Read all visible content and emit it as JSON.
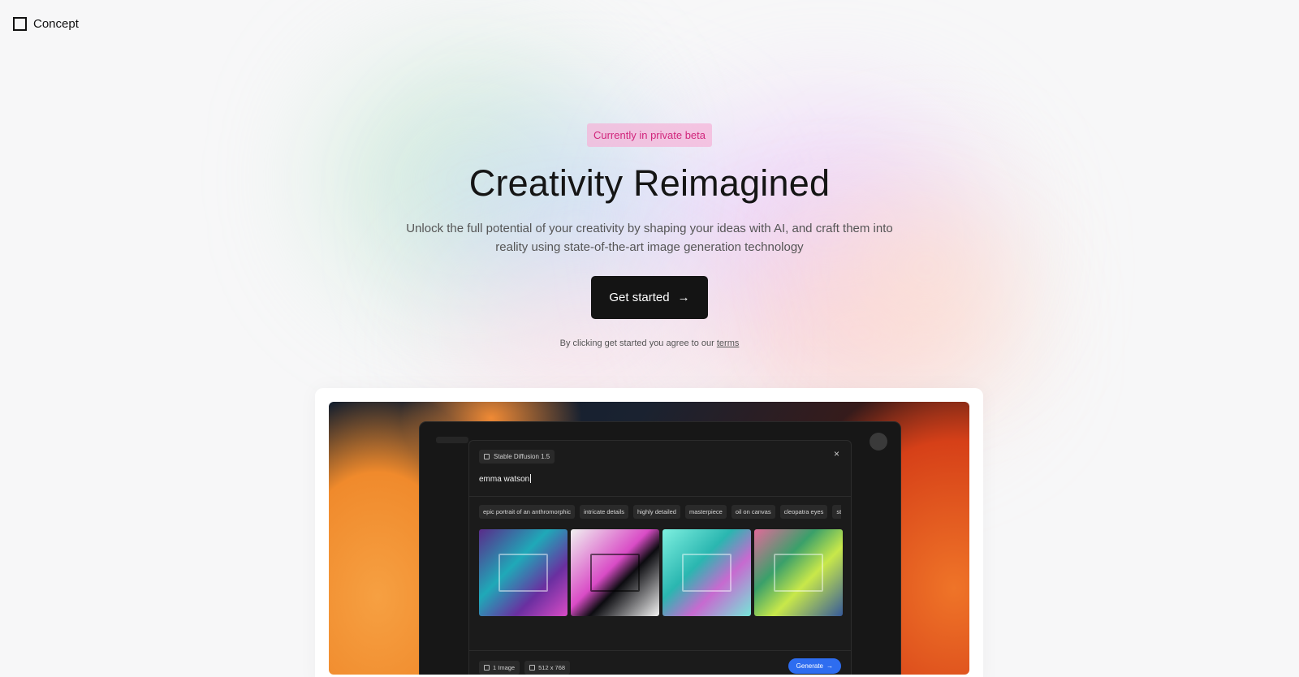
{
  "brand": {
    "name": "Concept"
  },
  "hero": {
    "badge": "Currently in private beta",
    "title": "Creativity Reimagined",
    "subtitle": "Unlock the full potential of your creativity by shaping your ideas with AI, and craft them into reality using state-of-the-art image generation technology",
    "cta_label": "Get started",
    "cta_icon": "→",
    "terms_prefix": "By clicking get started you agree to our ",
    "terms_link": "terms"
  },
  "preview": {
    "model": "Stable Diffusion 1.5",
    "close_icon": "×",
    "prompt": "emma watson",
    "tags": [
      "epic portrait of an anthromorphic",
      "intricate details",
      "highly detailed",
      "masterpiece",
      "oil on canvas",
      "cleopatra eyes",
      "stud"
    ],
    "count": "1 Image",
    "size": "512 x 768",
    "generate_label": "Generate",
    "generate_icon": "→"
  },
  "colors": {
    "badge_bg": "#f5b2d7",
    "badge_text": "#d1267c",
    "cta_bg": "#141414",
    "generate": "#2e6df0"
  }
}
